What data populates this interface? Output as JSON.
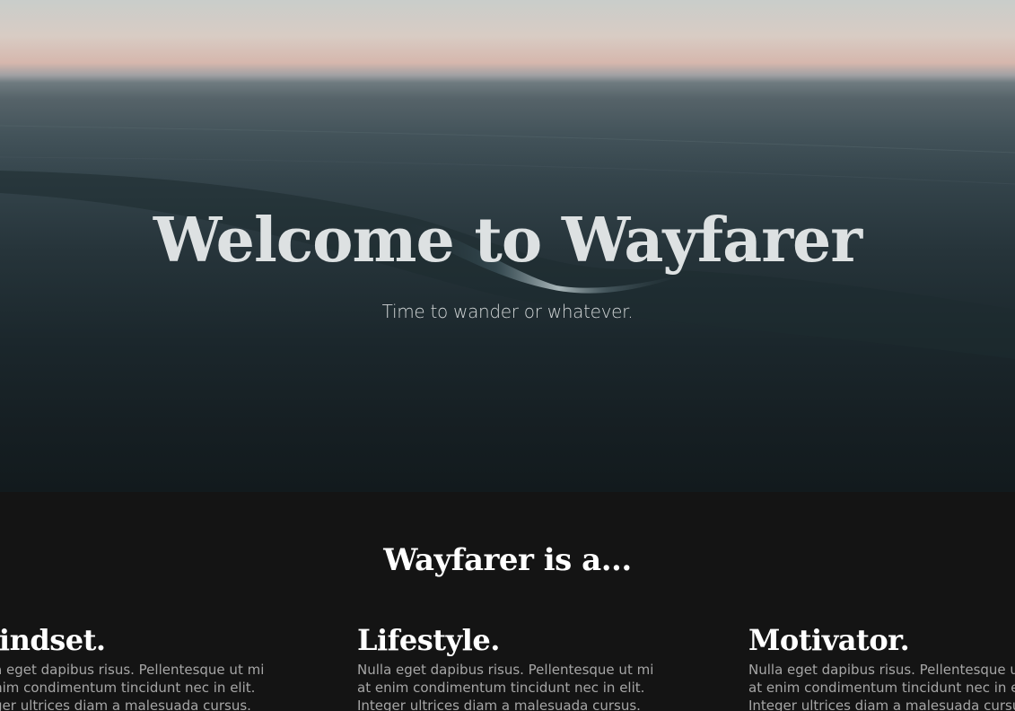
{
  "hero": {
    "title": "Welcome to Wayfarer",
    "subtitle": "Time to wander or whatever."
  },
  "about": {
    "heading": "Wayfarer is a...",
    "cards": [
      {
        "title": "Mindset.",
        "lines": [
          "Nulla eget dapibus risus. Pellentesque ut mi",
          "at enim condimentum tincidunt nec in elit.",
          "Integer ultrices diam a malesuada cursus."
        ]
      },
      {
        "title": "Lifestyle.",
        "lines": [
          "Nulla eget dapibus risus. Pellentesque ut mi",
          "at enim condimentum tincidunt nec in elit.",
          "Integer ultrices diam a malesuada cursus."
        ]
      },
      {
        "title": "Motivator.",
        "lines": [
          "Nulla eget dapibus risus. Pellentesque ut mi",
          "at enim condimentum tincidunt nec in elit.",
          "Integer ultrices diam a malesuada cursus."
        ]
      }
    ]
  }
}
